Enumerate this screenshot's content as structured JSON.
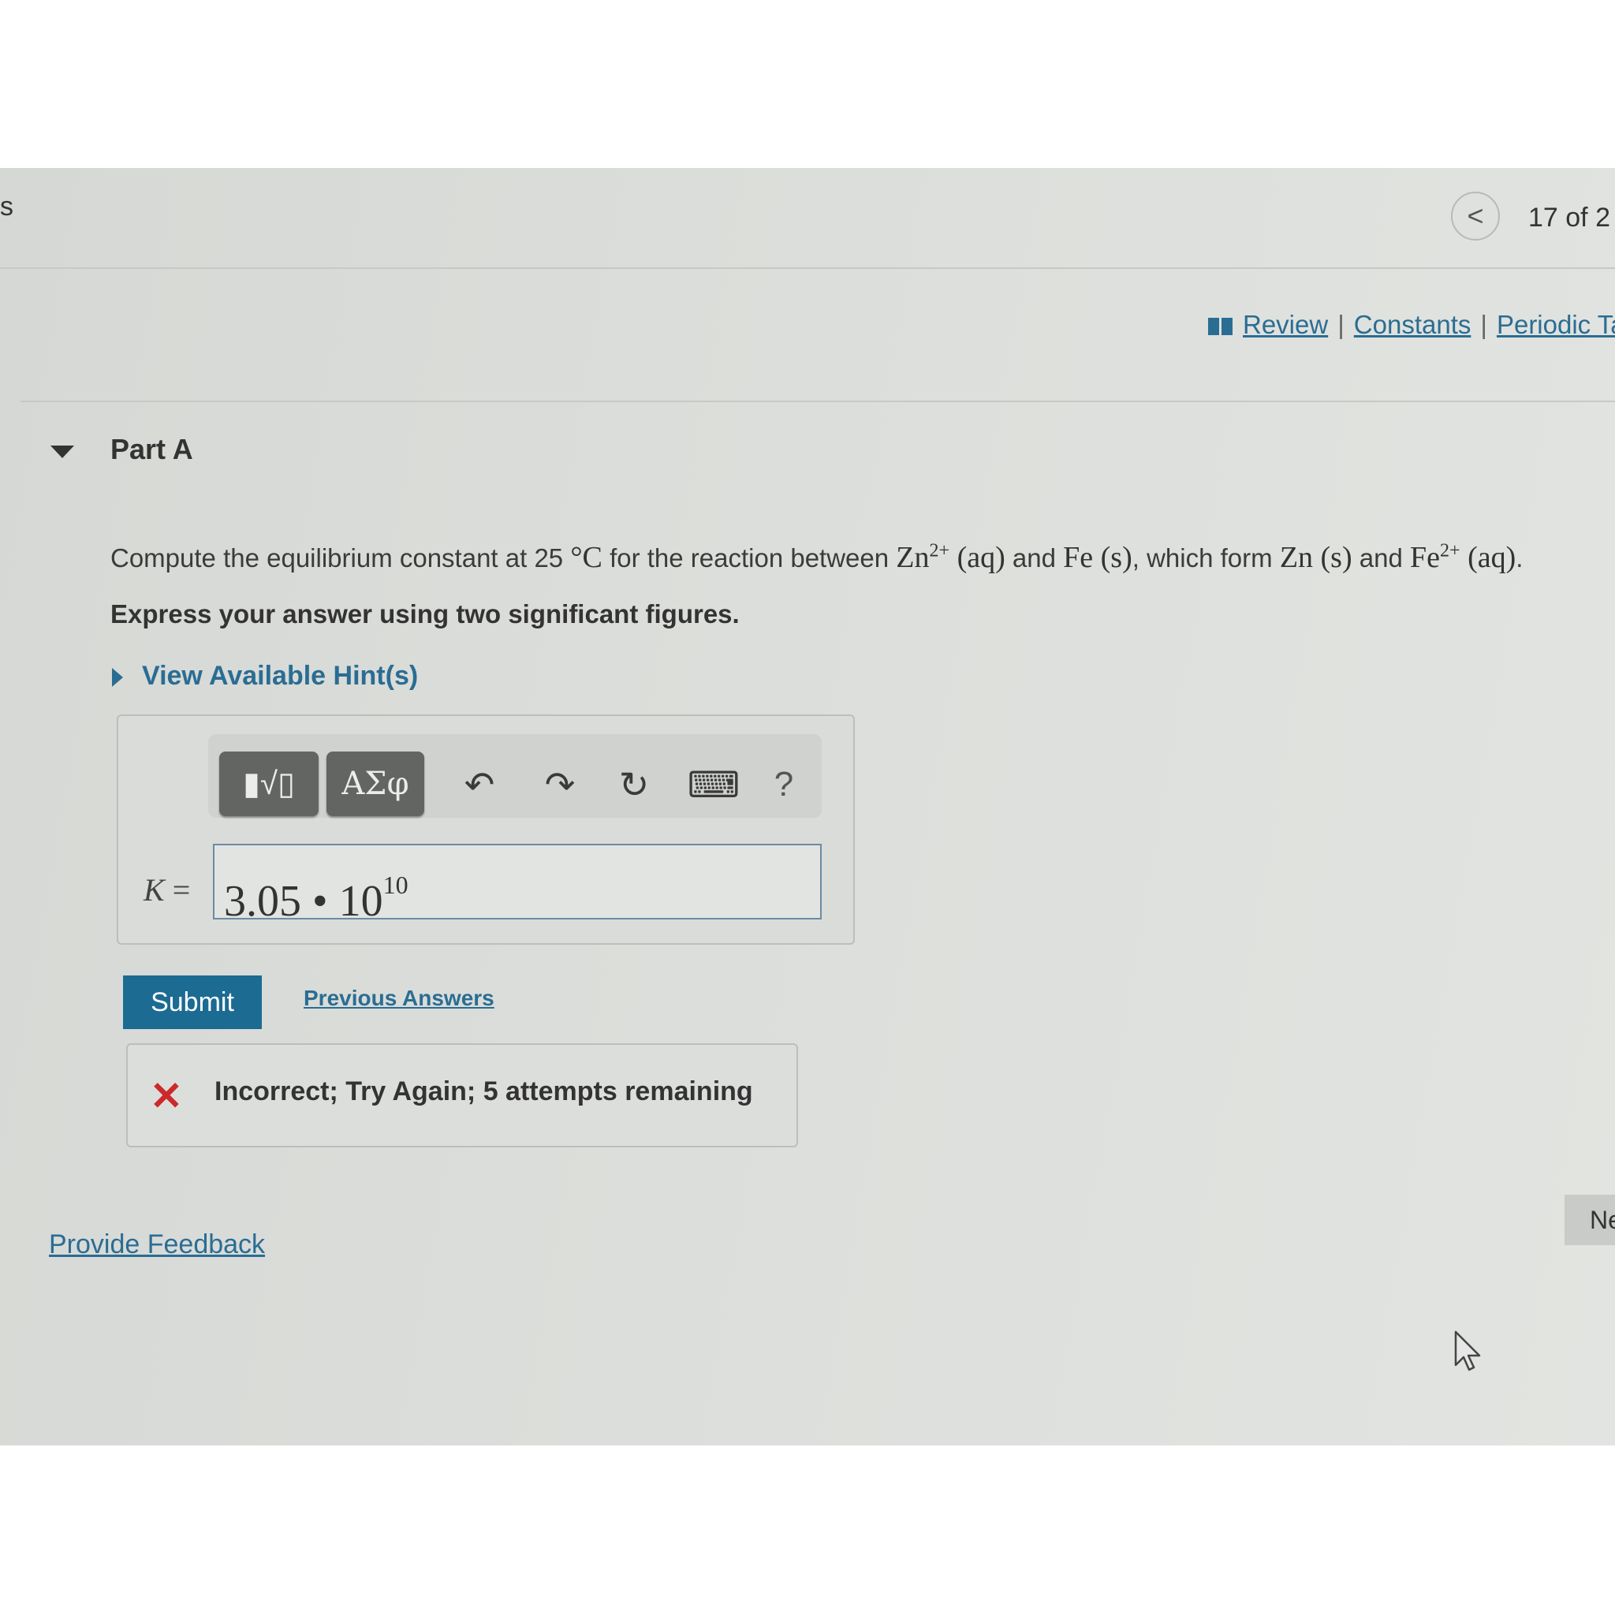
{
  "header": {
    "edge_text": "s",
    "back_icon": "chevron-left-icon",
    "back_glyph": "<",
    "page_counter": "17 of 2"
  },
  "links": {
    "review": "Review",
    "separator": "|",
    "constants": "Constants",
    "periodic_table": "Periodic Ta"
  },
  "part": {
    "title": "Part A",
    "question": {
      "prefix": "Compute the equilibrium constant at 25",
      "degree": "°C",
      "mid1": "for the reaction between",
      "zn": "Zn",
      "zn_charge": "2+",
      "aq1": "(aq)",
      "and1": "and",
      "fe_s": "Fe (s)",
      "mid2": ", which form",
      "zn_s": "Zn (s)",
      "and2": "and",
      "fe": "Fe",
      "fe_charge": "2+",
      "aq2": "(aq)",
      "end": "."
    },
    "instruction": "Express your answer using two significant figures.",
    "hint_link": "View Available Hint(s)"
  },
  "toolbar": {
    "templates_glyph": "▮√▯",
    "greek_label": "ΑΣφ",
    "undo_glyph": "↶",
    "redo_glyph": "↷",
    "reset_glyph": "↻",
    "keyboard_glyph": "⌨",
    "help_glyph": "?"
  },
  "answer": {
    "variable": "K",
    "equals": "=",
    "value_mantissa": "3.05",
    "value_dot": "•",
    "value_base": "10",
    "value_exponent": "10"
  },
  "actions": {
    "submit_label": "Submit",
    "previous_answers": "Previous Answers"
  },
  "feedback": {
    "icon_glyph": "✕",
    "message": "Incorrect; Try Again; 5 attempts remaining"
  },
  "footer": {
    "provide_feedback": "Provide Feedback",
    "next_label": "Ne"
  },
  "colors": {
    "link": "#2a6d93",
    "submit_bg": "#1b6b93",
    "error": "#cc2a2a"
  }
}
